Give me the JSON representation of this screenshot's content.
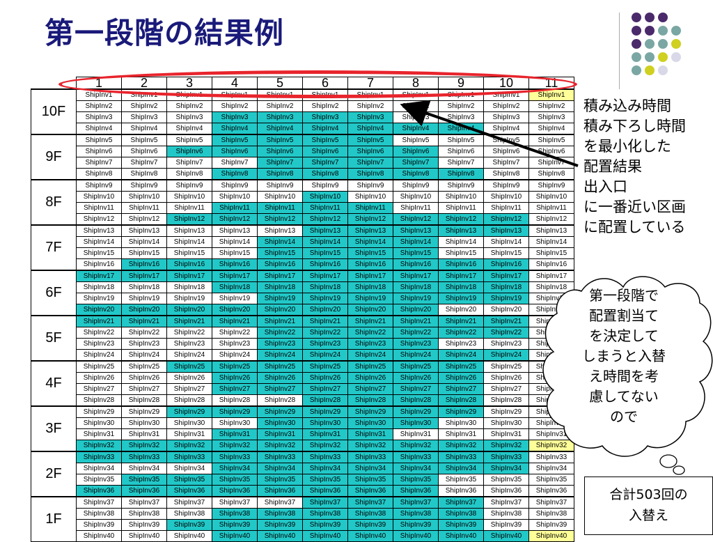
{
  "title": "第一段階の結果例",
  "colors": {
    "teal": "#22c8c8",
    "yellow": "#ffff99",
    "oval": "#e8242c",
    "title": "#1a1a7a"
  },
  "columns": [
    "1",
    "2",
    "3",
    "4",
    "5",
    "6",
    "7",
    "8",
    "9",
    "10",
    "11"
  ],
  "row_prefix": "ShipInv",
  "floors": [
    "10F",
    "9F",
    "8F",
    "7F",
    "6F",
    "5F",
    "4F",
    "3F",
    "2F",
    "1F"
  ],
  "highlights": [
    "00000000000",
    "00000000000",
    "00011110000",
    "00011111100",
    "00011110000",
    "00111111000",
    "00001111000",
    "00011111100",
    "00000000000",
    "00000100000",
    "00011110000",
    "00111111110",
    "00000111110",
    "00001111000",
    "00001111000",
    "01111111110",
    "11111111110",
    "00011111110",
    "00001111110",
    "11111111000",
    "11111111110",
    "00001111110",
    "00001111000",
    "00001111110",
    "00111111100",
    "00011111100",
    "00011111100",
    "00000111100",
    "00111111100",
    "00001111000",
    "00011110000",
    "11111111111",
    "11111111110",
    "00011111110",
    "01111111000",
    "11111111000",
    "00000111100",
    "00011111100",
    "00111111100",
    "00011111110"
  ],
  "yellow_cells": [
    [
      0,
      10
    ],
    [
      31,
      10
    ],
    [
      39,
      10
    ]
  ],
  "note_lines": [
    "積み込み時間",
    "積み下ろし時間",
    "を最小化した",
    "配置結果",
    "出入口",
    "に一番近い区画",
    "に配置している"
  ],
  "cloud_lines": [
    "第一段階で",
    "配置割当て",
    "を決定して",
    "しまうと入替",
    "え時間を考",
    "慮してない",
    "ので"
  ],
  "box_lines": [
    "合計503回の",
    "入替え"
  ]
}
